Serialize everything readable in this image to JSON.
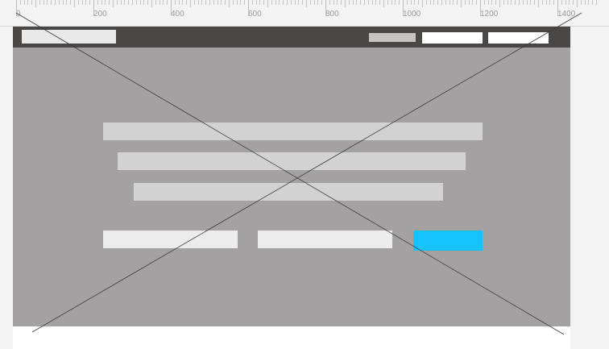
{
  "ruler": {
    "labels": [
      "0",
      "200",
      "400",
      "600",
      "800",
      "1000",
      "1200",
      "1400"
    ]
  },
  "colors": {
    "topbar": "#4a4846",
    "hero": "#a3a1a1",
    "text_placeholder": "#d3d2d2",
    "input_placeholder": "#ececec",
    "cta": "#16c3ff"
  }
}
